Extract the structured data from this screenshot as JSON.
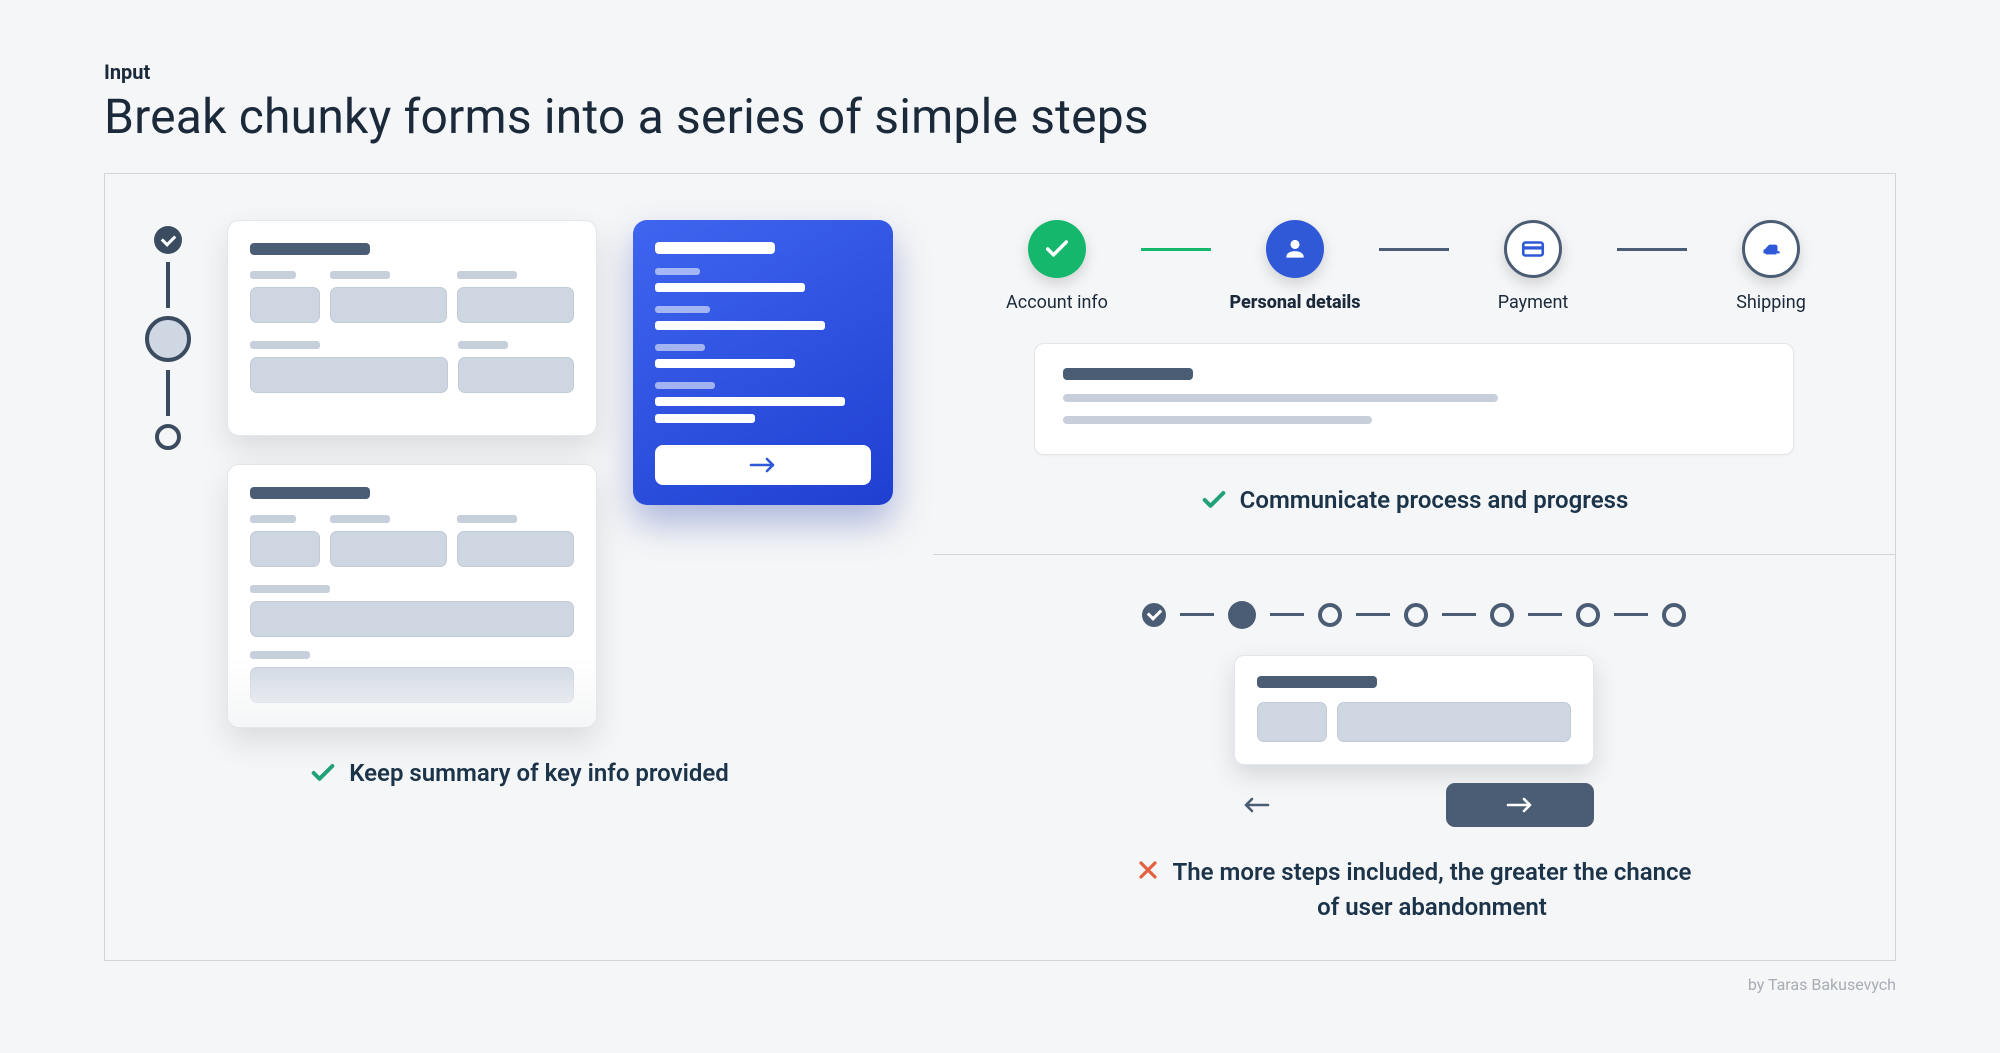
{
  "eyebrow": "Input",
  "title": "Break chunky forms into a series of simple steps",
  "panels": {
    "progress": {
      "steps": [
        {
          "label": "Account info",
          "state": "done"
        },
        {
          "label": "Personal details",
          "state": "active"
        },
        {
          "label": "Payment",
          "state": "pending"
        },
        {
          "label": "Shipping",
          "state": "pending"
        }
      ],
      "caption": "Communicate process and progress",
      "caption_kind": "good"
    },
    "too_many": {
      "step_count": 7,
      "caption": "The more steps included, the greater the chance of user abandonment",
      "caption_kind": "bad"
    },
    "summary": {
      "caption": "Keep summary of key info provided",
      "caption_kind": "good"
    }
  },
  "icons": {
    "check": "check-icon",
    "cross": "cross-icon",
    "user": "user-icon",
    "card": "card-icon",
    "ship": "shipping-icon",
    "arrow_right": "arrow-right-icon",
    "arrow_left": "arrow-left-icon"
  },
  "colors": {
    "green": "#21a179",
    "blue": "#2f59d6",
    "slate": "#4b5d74",
    "red": "#e0603f"
  },
  "credit": "by Taras Bakusevych"
}
